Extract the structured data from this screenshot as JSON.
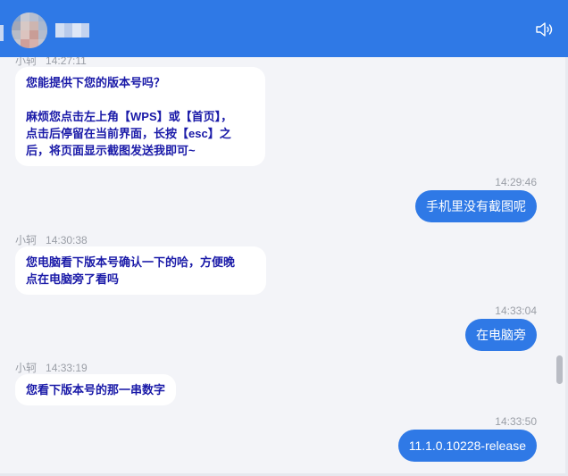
{
  "colors": {
    "header": "#2f79e6",
    "accent": "#2f79e6",
    "bubble_left_bg": "#ffffff",
    "bubble_left_text": "#1a1aa8",
    "timestamp": "#9a9ea6",
    "background": "#f3f4f8"
  },
  "header": {
    "speaker_icon": "speaker-icon"
  },
  "messages": [
    {
      "side": "left",
      "nick": "小轲",
      "time": "14:27:11",
      "lines": [
        "您能提供下您的版本号吗？",
        "",
        "麻烦您点击左上角【WPS】或【首页】，",
        "点击后停留在当前界面，长按【esc】之",
        "后，将页面显示截图发送我即可~"
      ]
    },
    {
      "side": "right",
      "time": "14:29:46",
      "text": "手机里没有截图呢"
    },
    {
      "side": "left",
      "nick": "小轲",
      "time": "14:30:38",
      "lines": [
        "您电脑看下版本号确认一下的哈，方便晚",
        "点在电脑旁了看吗"
      ]
    },
    {
      "side": "right",
      "time": "14:33:04",
      "text": "在电脑旁"
    },
    {
      "side": "left",
      "nick": "小轲",
      "time": "14:33:19",
      "lines": [
        "您看下版本号的那一串数字"
      ]
    },
    {
      "side": "right",
      "time": "14:33:50",
      "text": "11.1.0.10228-release"
    }
  ]
}
